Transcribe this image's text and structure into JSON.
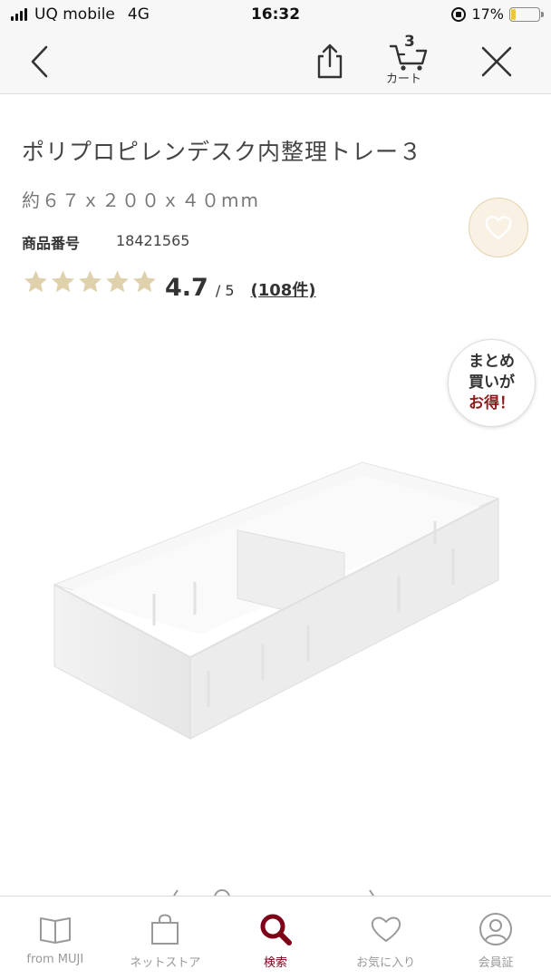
{
  "status_bar": {
    "carrier": "UQ mobile",
    "network": "4G",
    "time": "16:32",
    "battery_percent": "17%",
    "battery_level": 0.17,
    "battery_color": "#f2c33c"
  },
  "header": {
    "back_icon": "chevron-left-icon",
    "share_icon": "share-icon",
    "cart": {
      "count": "3",
      "label": "カート",
      "icon": "cart-icon"
    },
    "close_icon": "close-icon"
  },
  "product": {
    "title": "ポリプロピレンデスク内整理トレー３",
    "size": "約６７ｘ２００ｘ４０mm",
    "code_label": "商品番号",
    "code": "18421565",
    "rating": {
      "score": "4.7",
      "max": "/ 5",
      "count": "(108件)",
      "stars": 4.7,
      "star_color": "#e0d1ad"
    },
    "favorite_icon": "heart-icon",
    "bulk_badge": {
      "line1": "まとめ",
      "line2": "買いが",
      "line3": "お得！"
    }
  },
  "tab_bar": {
    "active_color": "#7f0019",
    "items": [
      {
        "label": "from MUJI",
        "icon": "book-icon"
      },
      {
        "label": "ネットストア",
        "icon": "bag-icon"
      },
      {
        "label": "検索",
        "icon": "search-icon"
      },
      {
        "label": "お気に入り",
        "icon": "heart-outline-icon"
      },
      {
        "label": "会員証",
        "icon": "member-icon"
      }
    ]
  }
}
